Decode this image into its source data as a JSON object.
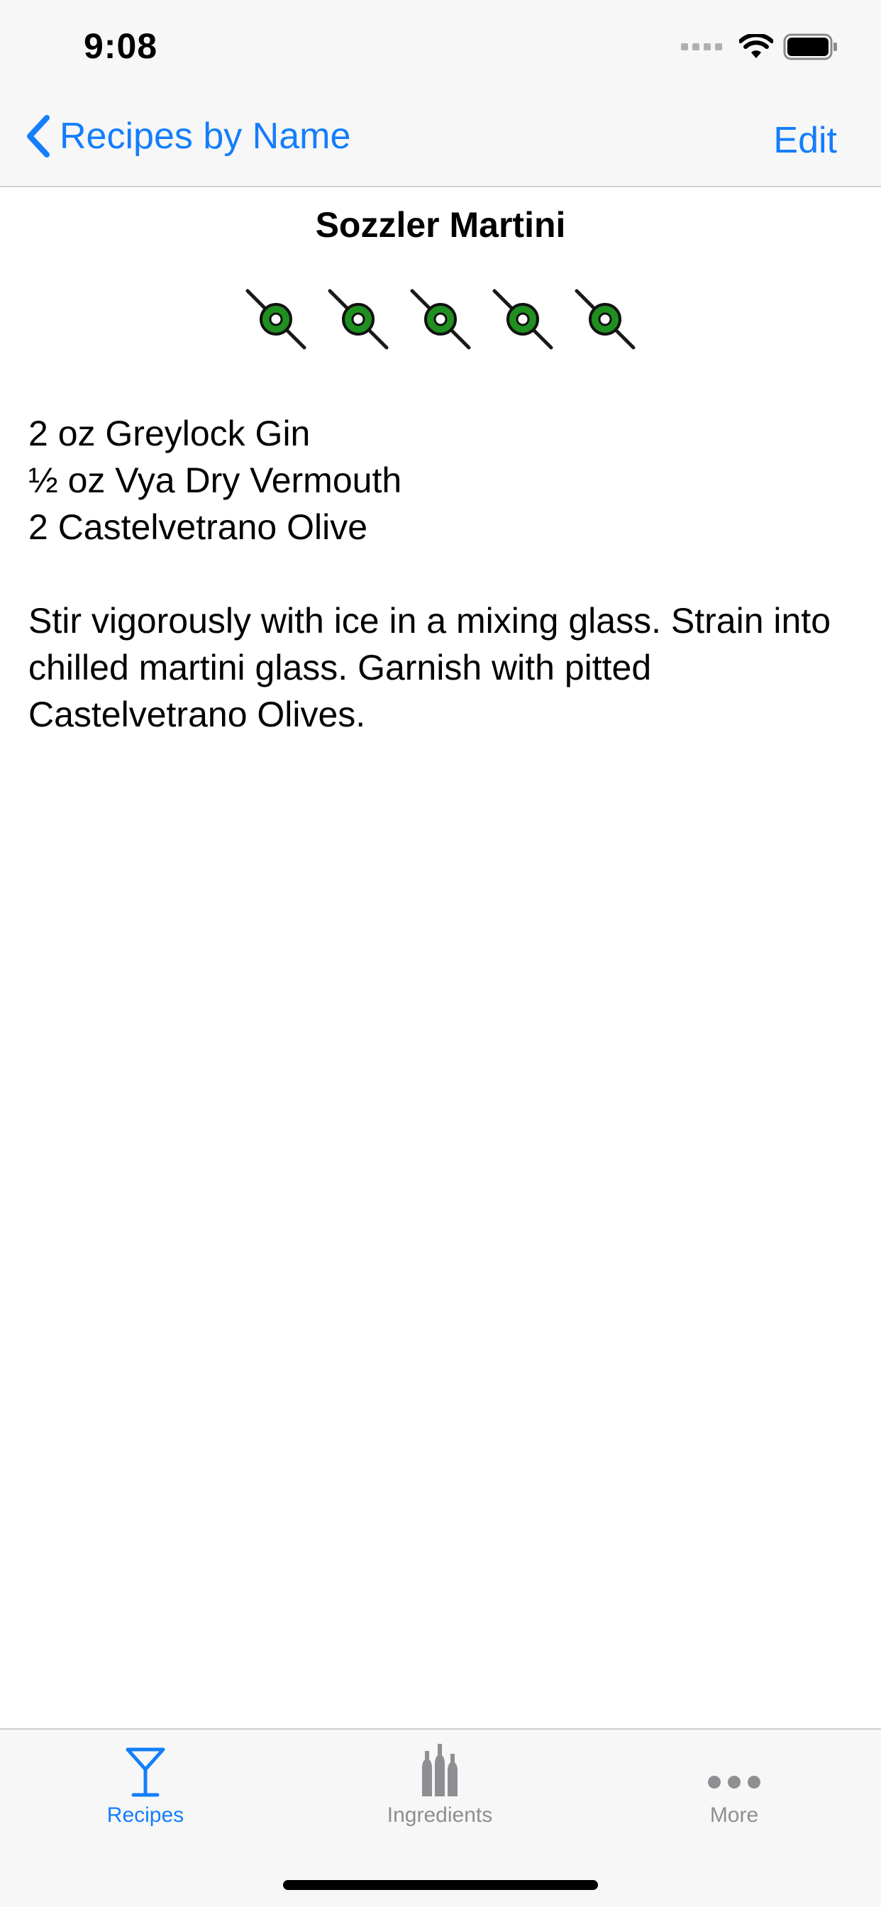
{
  "status_bar": {
    "time": "9:08"
  },
  "nav": {
    "back_label": "Recipes by Name",
    "edit_label": "Edit"
  },
  "recipe": {
    "title": "Sozzler Martini",
    "rating": 5,
    "rating_max": 5,
    "ingredients": [
      "2 oz Greylock Gin",
      "½ oz Vya Dry Vermouth",
      "2 Castelvetrano Olive"
    ],
    "instructions": "Stir vigorously with ice in a mixing glass. Strain into chilled martini glass. Garnish with pitted Castelvetrano Olives."
  },
  "tabs": [
    {
      "label": "Recipes",
      "icon": "martini-glass-icon",
      "active": true
    },
    {
      "label": "Ingredients",
      "icon": "bottles-icon",
      "active": false
    },
    {
      "label": "More",
      "icon": "more-dots-icon",
      "active": false
    }
  ],
  "colors": {
    "accent": "#147efb",
    "inactive_tab": "#8e8e93",
    "olive_green": "#1f8f1f",
    "bar_background": "#f7f7f7"
  }
}
